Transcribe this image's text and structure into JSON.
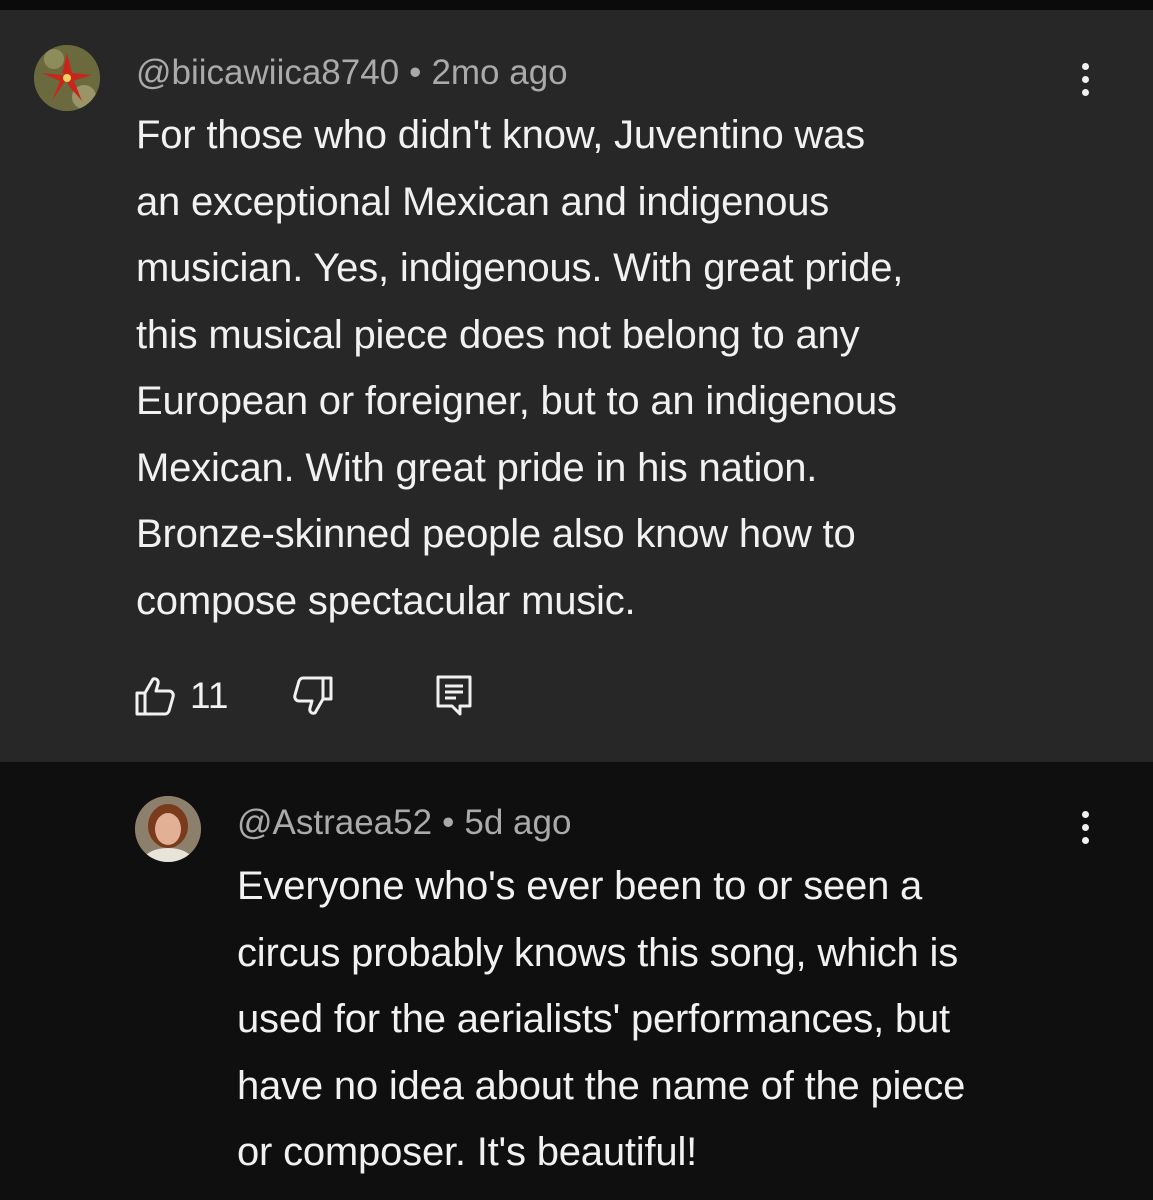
{
  "comment": {
    "author": "@biicawiica8740",
    "separator": "•",
    "time": "2mo ago",
    "lines": [
      "For those who didn't know, Juventino was",
      "an exceptional Mexican and indigenous",
      "musician. Yes, indigenous. With great pride,",
      "this musical piece does not belong to any",
      "European or foreigner, but to an indigenous",
      "Mexican. With great pride in his nation.",
      "Bronze-skinned people also know how to",
      "compose spectacular music."
    ],
    "like_count": "11",
    "icons": {
      "like": "thumbs-up-icon",
      "dislike": "thumbs-down-icon",
      "reply": "reply-icon",
      "menu": "more-vert-icon"
    }
  },
  "reply": {
    "author": "@Astraea52",
    "separator": "•",
    "time": "5d ago",
    "lines": [
      "Everyone who's ever been to or seen a",
      "circus probably knows this song, which is",
      "used for the aerialists' performances, but",
      "have no idea about the name of the piece",
      "or composer. It's beautiful!"
    ],
    "icons": {
      "menu": "more-vert-icon"
    }
  },
  "colors": {
    "comment_bg": "#272727",
    "reply_bg": "#0f0f0f",
    "text_primary": "#f1f1f1",
    "text_secondary": "#aaaaaa"
  }
}
